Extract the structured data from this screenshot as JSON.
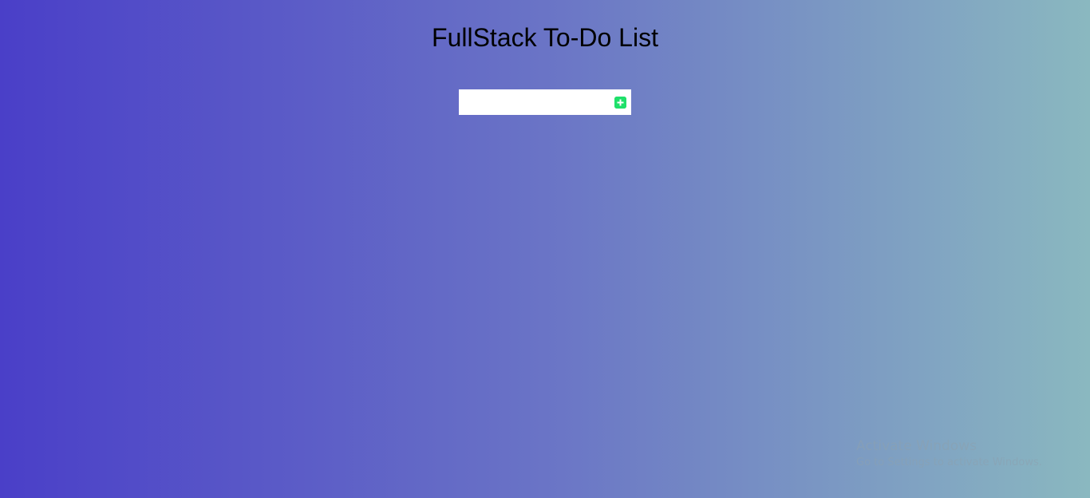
{
  "page": {
    "title": "FullStack To-Do List"
  },
  "todo_form": {
    "input_value": "",
    "add_icon": "plus-square-icon"
  },
  "watermark": {
    "title": "Activate Windows",
    "subtitle": "Go to Settings to activate Windows."
  },
  "colors": {
    "gradient_start": "#4a3fc8",
    "gradient_end": "#8ab8c0",
    "add_button": "#1fe06a"
  }
}
